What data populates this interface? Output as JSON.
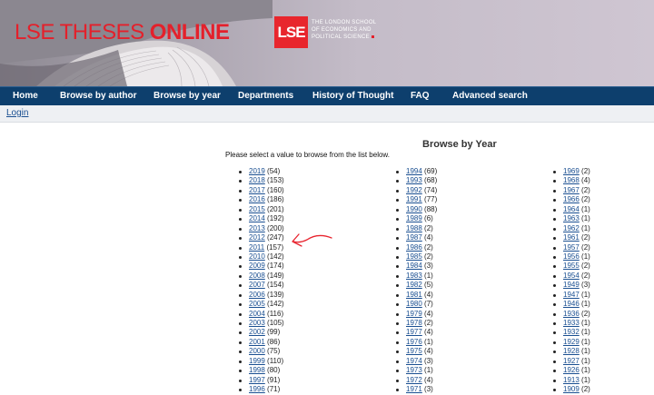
{
  "header": {
    "title_part1": "LSE THESES ",
    "title_part2": "ONLINE",
    "logo_text": "LSE",
    "institution_line1": "THE LONDON SCHOOL",
    "institution_line2": "OF ECONOMICS AND",
    "institution_line3": "POLITICAL SCIENCE"
  },
  "nav": {
    "items": [
      {
        "label": "Home"
      },
      {
        "label": "Browse by author"
      },
      {
        "label": "Browse by year"
      },
      {
        "label": "Departments"
      },
      {
        "label": "History of Thought"
      },
      {
        "label": "FAQ"
      },
      {
        "label": "Advanced search"
      }
    ]
  },
  "login_label": "Login",
  "page": {
    "heading": "Browse by Year",
    "instruction": "Please select a value to browse from the list below."
  },
  "years": {
    "col1": [
      {
        "year": "2019",
        "count": "(54)"
      },
      {
        "year": "2018",
        "count": "(153)"
      },
      {
        "year": "2017",
        "count": "(160)"
      },
      {
        "year": "2016",
        "count": "(186)"
      },
      {
        "year": "2015",
        "count": "(201)"
      },
      {
        "year": "2014",
        "count": "(192)"
      },
      {
        "year": "2013",
        "count": "(200)"
      },
      {
        "year": "2012",
        "count": "(247)"
      },
      {
        "year": "2011",
        "count": "(157)"
      },
      {
        "year": "2010",
        "count": "(142)"
      },
      {
        "year": "2009",
        "count": "(174)"
      },
      {
        "year": "2008",
        "count": "(149)"
      },
      {
        "year": "2007",
        "count": "(154)"
      },
      {
        "year": "2006",
        "count": "(139)"
      },
      {
        "year": "2005",
        "count": "(142)"
      },
      {
        "year": "2004",
        "count": "(116)"
      },
      {
        "year": "2003",
        "count": "(105)"
      },
      {
        "year": "2002",
        "count": "(99)"
      },
      {
        "year": "2001",
        "count": "(86)"
      },
      {
        "year": "2000",
        "count": "(75)"
      },
      {
        "year": "1999",
        "count": "(110)"
      },
      {
        "year": "1998",
        "count": "(80)"
      },
      {
        "year": "1997",
        "count": "(91)"
      },
      {
        "year": "1996",
        "count": "(71)"
      }
    ],
    "col2": [
      {
        "year": "1994",
        "count": "(69)"
      },
      {
        "year": "1993",
        "count": "(68)"
      },
      {
        "year": "1992",
        "count": "(74)"
      },
      {
        "year": "1991",
        "count": "(77)"
      },
      {
        "year": "1990",
        "count": "(88)"
      },
      {
        "year": "1989",
        "count": "(6)"
      },
      {
        "year": "1988",
        "count": "(2)"
      },
      {
        "year": "1987",
        "count": "(4)"
      },
      {
        "year": "1986",
        "count": "(2)"
      },
      {
        "year": "1985",
        "count": "(2)"
      },
      {
        "year": "1984",
        "count": "(3)"
      },
      {
        "year": "1983",
        "count": "(1)"
      },
      {
        "year": "1982",
        "count": "(5)"
      },
      {
        "year": "1981",
        "count": "(4)"
      },
      {
        "year": "1980",
        "count": "(7)"
      },
      {
        "year": "1979",
        "count": "(4)"
      },
      {
        "year": "1978",
        "count": "(2)"
      },
      {
        "year": "1977",
        "count": "(4)"
      },
      {
        "year": "1976",
        "count": "(1)"
      },
      {
        "year": "1975",
        "count": "(4)"
      },
      {
        "year": "1974",
        "count": "(3)"
      },
      {
        "year": "1973",
        "count": "(1)"
      },
      {
        "year": "1972",
        "count": "(4)"
      },
      {
        "year": "1971",
        "count": "(3)"
      }
    ],
    "col3": [
      {
        "year": "1969",
        "count": "(2)"
      },
      {
        "year": "1968",
        "count": "(4)"
      },
      {
        "year": "1967",
        "count": "(2)"
      },
      {
        "year": "1966",
        "count": "(2)"
      },
      {
        "year": "1964",
        "count": "(1)"
      },
      {
        "year": "1963",
        "count": "(1)"
      },
      {
        "year": "1962",
        "count": "(1)"
      },
      {
        "year": "1961",
        "count": "(2)"
      },
      {
        "year": "1957",
        "count": "(2)"
      },
      {
        "year": "1956",
        "count": "(1)"
      },
      {
        "year": "1955",
        "count": "(2)"
      },
      {
        "year": "1954",
        "count": "(2)"
      },
      {
        "year": "1949",
        "count": "(3)"
      },
      {
        "year": "1947",
        "count": "(1)"
      },
      {
        "year": "1946",
        "count": "(1)"
      },
      {
        "year": "1936",
        "count": "(2)"
      },
      {
        "year": "1933",
        "count": "(1)"
      },
      {
        "year": "1932",
        "count": "(1)"
      },
      {
        "year": "1929",
        "count": "(1)"
      },
      {
        "year": "1928",
        "count": "(1)"
      },
      {
        "year": "1927",
        "count": "(1)"
      },
      {
        "year": "1926",
        "count": "(1)"
      },
      {
        "year": "1913",
        "count": "(1)"
      },
      {
        "year": "1909",
        "count": "(2)"
      }
    ]
  },
  "annotation": {
    "color": "#e8242f"
  },
  "colors": {
    "nav": "#0d3f6d",
    "link": "#1a4f91",
    "brand_red": "#e4202b"
  }
}
